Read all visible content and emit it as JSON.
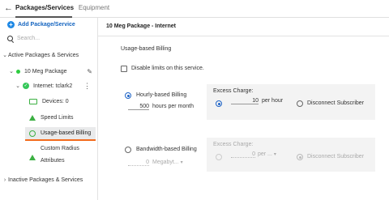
{
  "top_tabs": {
    "back_icon": "arrow-left-icon",
    "active": "Packages/Services",
    "inactive": "Equipment"
  },
  "sidebar": {
    "add_label": "Add Package/Service",
    "search_placeholder": "Search...",
    "active_section": "Active Packages & Services",
    "package": "10 Meg Package",
    "internet": "Internet: tclark2",
    "items": [
      "Devices: 0",
      "Speed Limits",
      "Usage-based Billing"
    ],
    "custom_radius_1": "Custom Radius",
    "custom_radius_2": "Attributes",
    "inactive_section": "Inactive Packages & Services"
  },
  "main": {
    "title": "10 Meg Package - Internet",
    "section": "Usage-based Billing",
    "disable_limits": "Disable limits on this service.",
    "hourly": {
      "label": "Hourly-based Billing",
      "value": "500",
      "unit": "hours per month",
      "excess_label": "Excess Charge:",
      "excess_value": "10",
      "excess_unit": "per hour",
      "disconnect": "Disconnect Subscriber"
    },
    "bandwidth": {
      "label": "Bandwidth-based Billing",
      "value": "0",
      "unit": "Megabyt...",
      "excess_label": "Excess Charge:",
      "excess_value": "0",
      "excess_unit": "per ...",
      "disconnect": "Disconnect Subscriber"
    }
  },
  "colors": {
    "accent": "#1e63c6",
    "green": "#34c759",
    "underline": "#f26b1d"
  }
}
